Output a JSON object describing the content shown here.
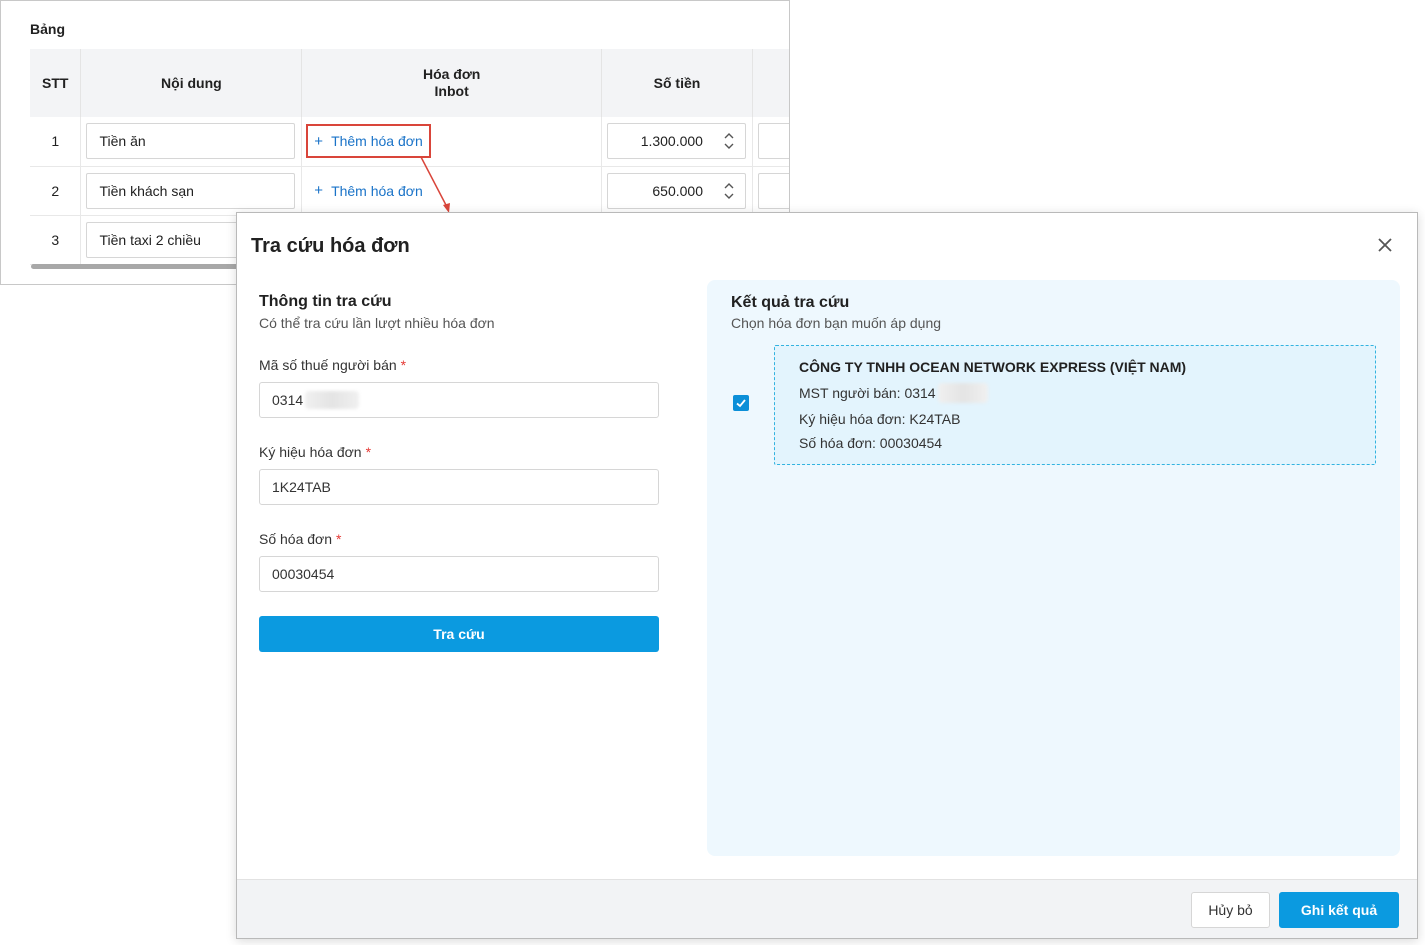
{
  "table": {
    "title": "Bảng",
    "headers": {
      "stt": "STT",
      "noi_dung": "Nội dung",
      "hoa_don_line1": "Hóa đơn",
      "hoa_don_line2": "Inbot",
      "so_tien": "Số tiền"
    },
    "rows": [
      {
        "stt": "1",
        "noi_dung": "Tiền ăn",
        "link": "Thêm hóa đơn",
        "so_tien": "1.300.000"
      },
      {
        "stt": "2",
        "noi_dung": "Tiền khách sạn",
        "link": "Thêm hóa đơn",
        "so_tien": "650.000"
      },
      {
        "stt": "3",
        "noi_dung": "Tiền taxi 2 chiều"
      }
    ],
    "plus_glyph": "+"
  },
  "dialog": {
    "title": "Tra cứu hóa đơn",
    "lookup": {
      "title": "Thông tin tra cứu",
      "subtitle": "Có thể tra cứu lần lượt nhiều hóa đơn",
      "tax_code_label": "Mã số thuế người bán",
      "tax_code_value": "0314",
      "symbol_label": "Ký hiệu hóa đơn",
      "symbol_value": "1K24TAB",
      "number_label": "Số hóa đơn",
      "number_value": "00030454",
      "required_mark": "*",
      "search_button": "Tra cứu"
    },
    "result": {
      "title": "Kết quả tra cứu",
      "subtitle": "Chọn hóa đơn bạn muốn áp dụng",
      "checked": true,
      "company": "CÔNG TY TNHH OCEAN NETWORK EXPRESS (VIỆT NAM)",
      "seller_tax": "MST người bán: 0314",
      "symbol": "Ký hiệu hóa đơn: K24TAB",
      "number": "Số hóa đơn: 00030454"
    },
    "footer": {
      "cancel": "Hủy bỏ",
      "save": "Ghi kết quả"
    }
  },
  "colors": {
    "primary": "#0b9ae0",
    "link": "#1a73c8",
    "highlight": "#d9453a",
    "result_bg": "#eef8fe",
    "required": "#e53935"
  }
}
